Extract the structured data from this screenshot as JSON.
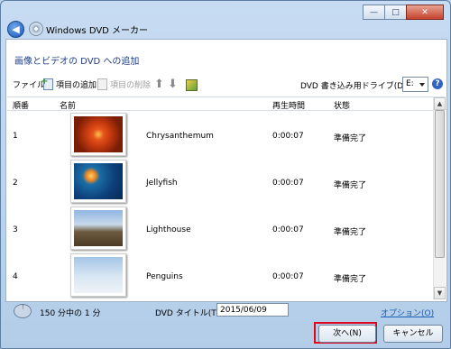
{
  "window": {
    "title": "Windows DVD メーカー",
    "controls": {
      "minimize": "—",
      "maximize": "□",
      "close": "✕"
    }
  },
  "page": {
    "heading": "画像とビデオの DVD への追加"
  },
  "toolbar": {
    "file_label": "ファイル",
    "add_item_label": "項目の追加",
    "remove_item_label": "項目の削除",
    "move_up_icon": "arrow-up-icon",
    "move_down_icon": "arrow-down-icon",
    "burn_drive_label": "DVD 書き込み用ドライブ(D):",
    "drive_value": "E:",
    "help_glyph": "?"
  },
  "list": {
    "columns": [
      "順番",
      "名前",
      "再生時間",
      "状態"
    ],
    "rows": [
      {
        "order": "1",
        "name": "Chrysanthemum",
        "duration": "0:00:07",
        "status": "準備完了"
      },
      {
        "order": "2",
        "name": "Jellyfish",
        "duration": "0:00:07",
        "status": "準備完了"
      },
      {
        "order": "3",
        "name": "Lighthouse",
        "duration": "0:00:07",
        "status": "準備完了"
      },
      {
        "order": "4",
        "name": "Penguins",
        "duration": "0:00:07",
        "status": "準備完了"
      }
    ]
  },
  "status": {
    "capacity_text": "150 分中の 1 分",
    "dvd_title_label": "DVD タイトル(T):",
    "dvd_title_value": "2015/06/09",
    "options_link": "オプション(O)"
  },
  "buttons": {
    "next": "次へ(N)",
    "cancel": "キャンセル"
  },
  "colors": {
    "highlight": "#e2051b",
    "link": "#1a5fb4",
    "heading": "#1f3c8a"
  }
}
